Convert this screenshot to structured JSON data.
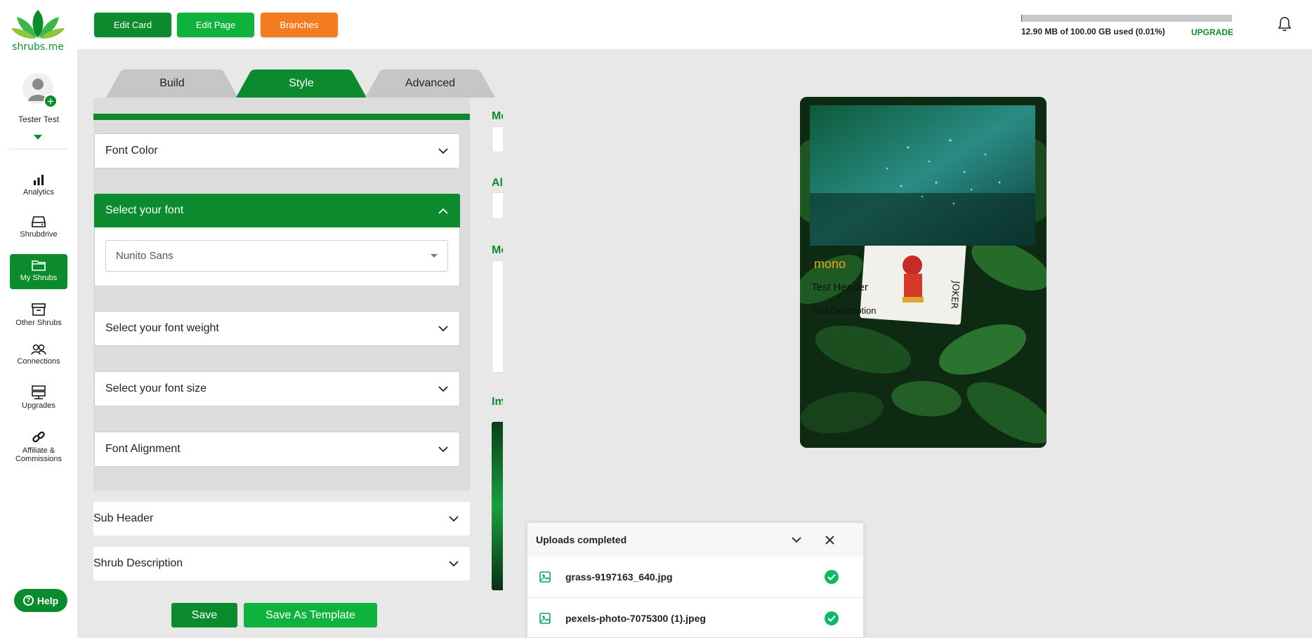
{
  "brand": {
    "name": "shrubs.me",
    "green": "#0c8a2e",
    "light_green": "#0fb23c",
    "orange": "#f47c20"
  },
  "user": {
    "name": "Tester Test"
  },
  "sidebar": {
    "items": [
      {
        "label": "Analytics",
        "icon": "bar-chart-icon"
      },
      {
        "label": "Shrubdrive",
        "icon": "drive-icon"
      },
      {
        "label": "My Shrubs",
        "icon": "folder-icon",
        "active": true
      },
      {
        "label": "Other Shrubs",
        "icon": "archive-icon"
      },
      {
        "label": "Connections",
        "icon": "people-icon"
      },
      {
        "label": "Upgrades",
        "icon": "server-icon"
      },
      {
        "label": "Affiliate &",
        "label2": "Commissions",
        "icon": "link-icon"
      }
    ],
    "help": "Help"
  },
  "toolbar": {
    "edit_card": "Edit Card",
    "edit_page": "Edit Page",
    "branches": "Branches"
  },
  "storage": {
    "text": "12.90 MB of 100.00 GB used (0.01%)",
    "upgrade": "UPGRADE",
    "used_fraction": 0.0001
  },
  "tabs": [
    {
      "label": "Build"
    },
    {
      "label": "Style",
      "active": true
    },
    {
      "label": "Advanced"
    }
  ],
  "style_panel": {
    "font_color": "Font Color",
    "select_font": "Select your font",
    "selected_font": "Nunito Sans",
    "font_weight": "Select your font weight",
    "font_size": "Select your font size",
    "font_alignment": "Font Alignment",
    "sub_header": "Sub Header",
    "shrub_description": "Shrub Description"
  },
  "actions": {
    "save": "Save",
    "save_template": "Save As Template"
  },
  "mid_column": {
    "label1": "Mo",
    "label2": "Al",
    "label3": "Mo",
    "label4": "Im"
  },
  "preview": {
    "title": "mono",
    "header": "Test Header",
    "description": "Test Description"
  },
  "uploads": {
    "title": "Uploads completed",
    "files": [
      {
        "name": "grass-9197163_640.jpg"
      },
      {
        "name": "pexels-photo-7075300 (1).jpeg"
      }
    ]
  }
}
